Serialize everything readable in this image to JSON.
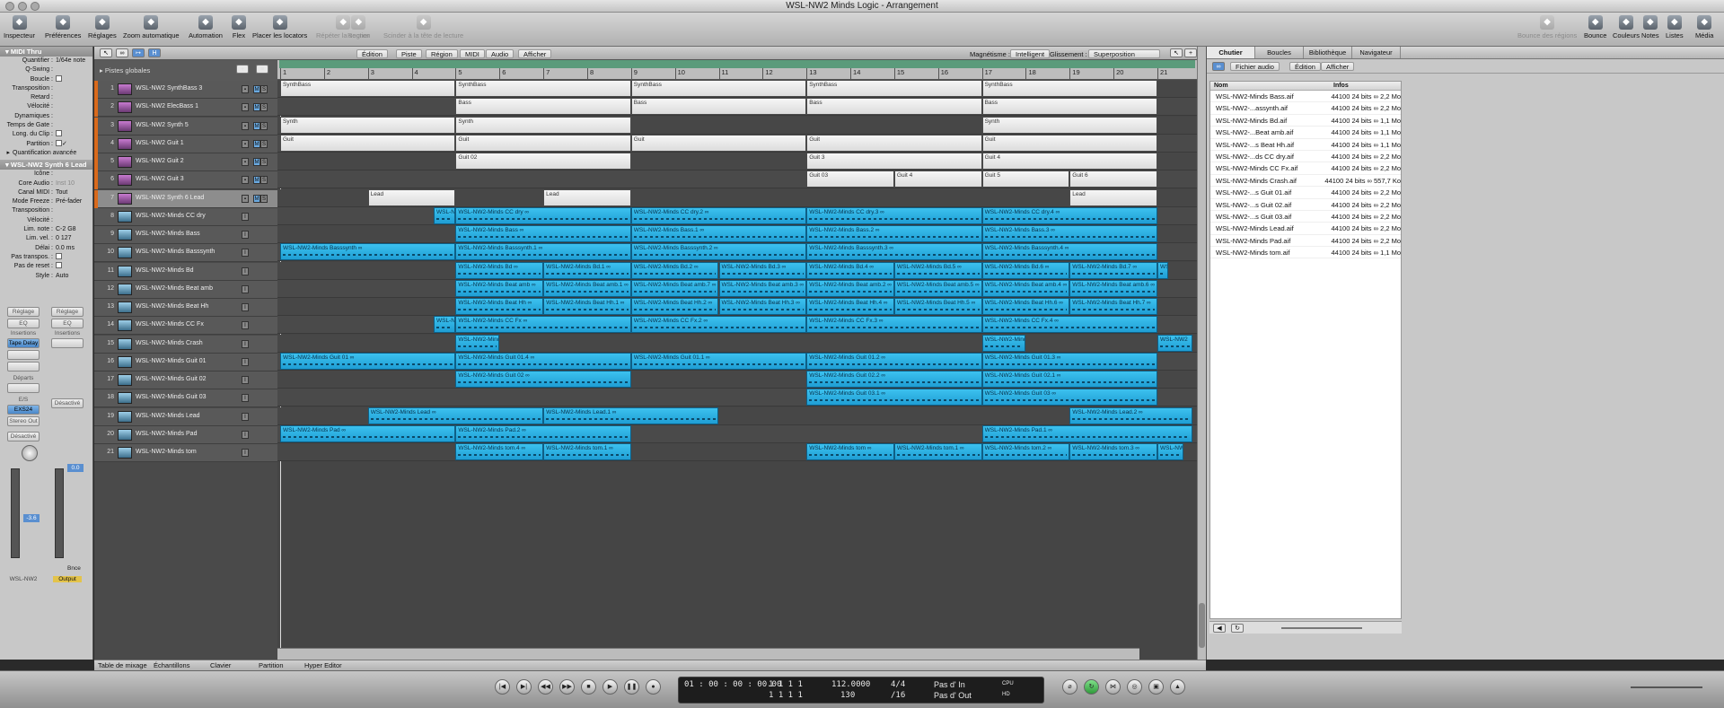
{
  "window": {
    "title": "WSL-NW2 Minds Logic - Arrangement"
  },
  "toolbar": {
    "left": [
      {
        "label": "Inspecteur",
        "icon": "info-icon"
      },
      {
        "label": "Préférences",
        "icon": "switch-icon"
      },
      {
        "label": "Réglages",
        "icon": "sliders-icon"
      },
      {
        "label": "Zoom automatique",
        "icon": "zoom-icon"
      },
      {
        "label": "Automation",
        "icon": "automation-icon"
      },
      {
        "label": "Flex",
        "icon": "flex-icon"
      },
      {
        "label": "Placer les locators",
        "icon": "locators-icon"
      },
      {
        "label": "Répéter la section",
        "icon": "repeat-icon",
        "disabled": true
      },
      {
        "label": "Rogner",
        "icon": "crop-icon",
        "disabled": true
      },
      {
        "label": "Scinder à la tête de lecture",
        "icon": "split-icon",
        "disabled": true
      }
    ],
    "right": [
      {
        "label": "Bounce des régions",
        "icon": "bounce-regions-icon",
        "disabled": true
      },
      {
        "label": "Bounce",
        "icon": "bounce-icon"
      },
      {
        "label": "Couleurs",
        "icon": "colors-icon"
      },
      {
        "label": "Notes",
        "icon": "notes-icon"
      },
      {
        "label": "Listes",
        "icon": "lists-icon"
      },
      {
        "label": "Média",
        "icon": "media-icon"
      }
    ]
  },
  "inspector": {
    "region_header": "MIDI Thru",
    "region_params": [
      {
        "k": "Quantifier :",
        "v": "1/64e note"
      },
      {
        "k": "Q-Swing :",
        "v": ""
      },
      {
        "k": "Boucle :",
        "v": "",
        "cb": true
      },
      {
        "k": "Transposition :",
        "v": ""
      },
      {
        "k": "Retard :",
        "v": ""
      },
      {
        "k": "Vélocité :",
        "v": ""
      },
      {
        "k": "Dynamiques :",
        "v": ""
      },
      {
        "k": "Temps de Gate :",
        "v": ""
      },
      {
        "k": "Long. du Clip :",
        "v": "",
        "cb": true
      },
      {
        "k": "Partition :",
        "v": "✓",
        "cb": true
      }
    ],
    "quant_adv": "Quantification avancée",
    "track_header": "WSL-NW2 Synth 6 Lead",
    "track_params": [
      {
        "k": "Icône :",
        "v": ""
      },
      {
        "k": "Core Audio :",
        "v": "Inst 10",
        "dim": true
      },
      {
        "k": "Canal MIDI :",
        "v": "Tout"
      },
      {
        "k": "Mode Freeze :",
        "v": "Pré-fader"
      },
      {
        "k": "Transposition :",
        "v": ""
      },
      {
        "k": "Vélocité :",
        "v": ""
      },
      {
        "k": "Lim. note :",
        "v": "C-2  G8"
      },
      {
        "k": "Lim. vel. :",
        "v": "0      127"
      },
      {
        "k": "Délai :",
        "v": "0.0 ms"
      },
      {
        "k": "Pas transpos. :",
        "v": "",
        "cb": true
      },
      {
        "k": "Pas de reset :",
        "v": "",
        "cb": true
      },
      {
        "k": "Style :",
        "v": "Auto"
      }
    ],
    "strip1": {
      "reglage": "Réglage",
      "eq": "EQ",
      "insertions": "Insertions",
      "insert1": "Tape Delay",
      "departs": "Départs",
      "es": "E/S",
      "input": "EXS24",
      "output": "Stereo Out",
      "mode": "Désactivé",
      "value": "-3.6",
      "name": "WSL-NW2"
    },
    "strip2": {
      "reglage": "Réglage",
      "eq": "EQ",
      "insertions": "Insertions",
      "mode": "Désactivé",
      "value": "0.0",
      "bnce": "Bnce",
      "name": "Output"
    }
  },
  "tracklist": {
    "globals": "Pistes globales"
  },
  "tracks": [
    {
      "n": "1",
      "name": "WSL-NW2 SynthBass 3",
      "type": "midi"
    },
    {
      "n": "2",
      "name": "WSL-NW2 ElecBass 1",
      "type": "midi"
    },
    {
      "n": "3",
      "name": "WSL-NW2 Synth 5",
      "type": "midi"
    },
    {
      "n": "4",
      "name": "WSL-NW2 Guit 1",
      "type": "midi"
    },
    {
      "n": "5",
      "name": "WSL-NW2 Guit 2",
      "type": "midi"
    },
    {
      "n": "6",
      "name": "WSL-NW2 Guit 3",
      "type": "midi"
    },
    {
      "n": "7",
      "name": "WSL-NW2 Synth 6 Lead",
      "type": "midi",
      "selected": true
    },
    {
      "n": "8",
      "name": "WSL-NW2-Minds CC dry",
      "type": "audio"
    },
    {
      "n": "9",
      "name": "WSL-NW2-Minds Bass",
      "type": "audio"
    },
    {
      "n": "10",
      "name": "WSL-NW2-Minds Basssynth",
      "type": "audio"
    },
    {
      "n": "11",
      "name": "WSL-NW2-Minds Bd",
      "type": "audio"
    },
    {
      "n": "12",
      "name": "WSL-NW2-Minds Beat amb",
      "type": "audio"
    },
    {
      "n": "13",
      "name": "WSL-NW2-Minds Beat Hh",
      "type": "audio"
    },
    {
      "n": "14",
      "name": "WSL-NW2-Minds CC Fx",
      "type": "audio"
    },
    {
      "n": "15",
      "name": "WSL-NW2-Minds Crash",
      "type": "audio"
    },
    {
      "n": "16",
      "name": "WSL-NW2-Minds Guit 01",
      "type": "audio"
    },
    {
      "n": "17",
      "name": "WSL-NW2-Minds Guit 02",
      "type": "audio"
    },
    {
      "n": "18",
      "name": "WSL-NW2-Minds Guit 03",
      "type": "audio"
    },
    {
      "n": "19",
      "name": "WSL-NW2-Minds Lead",
      "type": "audio"
    },
    {
      "n": "20",
      "name": "WSL-NW2-Minds Pad",
      "type": "audio"
    },
    {
      "n": "21",
      "name": "WSL-NW2-Minds tom",
      "type": "audio"
    }
  ],
  "arrange": {
    "menus": [
      "Édition",
      "Piste",
      "Région",
      "MIDI",
      "Audio",
      "Afficher"
    ],
    "magnet_label": "Magnétisme :",
    "magnet": "Intelligent",
    "glisse_label": "Glissement :",
    "glisse": "Superposition",
    "bars": [
      "1",
      "2",
      "3",
      "4",
      "5",
      "6",
      "7",
      "8",
      "9",
      "10",
      "11",
      "12",
      "13",
      "14",
      "15",
      "16",
      "17",
      "18",
      "19",
      "20",
      "21"
    ]
  },
  "regions": [
    {
      "t": 0,
      "s": 1,
      "e": 5,
      "label": "SynthBass",
      "k": "midi"
    },
    {
      "t": 0,
      "s": 5,
      "e": 9,
      "label": "SynthBass",
      "k": "midi"
    },
    {
      "t": 0,
      "s": 9,
      "e": 13,
      "label": "SynthBass",
      "k": "midi"
    },
    {
      "t": 0,
      "s": 13,
      "e": 17,
      "label": "SynthBass",
      "k": "midi"
    },
    {
      "t": 0,
      "s": 17,
      "e": 21,
      "label": "SynthBass",
      "k": "midi"
    },
    {
      "t": 1,
      "s": 5,
      "e": 9,
      "label": "Bass",
      "k": "midi"
    },
    {
      "t": 1,
      "s": 9,
      "e": 13,
      "label": "Bass",
      "k": "midi"
    },
    {
      "t": 1,
      "s": 13,
      "e": 17,
      "label": "Bass",
      "k": "midi"
    },
    {
      "t": 1,
      "s": 17,
      "e": 21,
      "label": "Bass",
      "k": "midi"
    },
    {
      "t": 2,
      "s": 1,
      "e": 5,
      "label": "Synth",
      "k": "midi"
    },
    {
      "t": 2,
      "s": 5,
      "e": 9,
      "label": "Synth",
      "k": "midi"
    },
    {
      "t": 2,
      "s": 17,
      "e": 21,
      "label": "Synth",
      "k": "midi"
    },
    {
      "t": 3,
      "s": 1,
      "e": 5,
      "label": "Guit",
      "k": "midi"
    },
    {
      "t": 3,
      "s": 5,
      "e": 9,
      "label": "Guit",
      "k": "midi"
    },
    {
      "t": 3,
      "s": 9,
      "e": 13,
      "label": "Guit",
      "k": "midi"
    },
    {
      "t": 3,
      "s": 13,
      "e": 17,
      "label": "Guit",
      "k": "midi"
    },
    {
      "t": 3,
      "s": 17,
      "e": 21,
      "label": "Guit",
      "k": "midi"
    },
    {
      "t": 4,
      "s": 5,
      "e": 9,
      "label": "Guit 02",
      "k": "midi"
    },
    {
      "t": 4,
      "s": 13,
      "e": 17,
      "label": "Guit 3",
      "k": "midi"
    },
    {
      "t": 4,
      "s": 17,
      "e": 21,
      "label": "Guit 4",
      "k": "midi"
    },
    {
      "t": 5,
      "s": 13,
      "e": 15,
      "label": "Guit 03",
      "k": "midi"
    },
    {
      "t": 5,
      "s": 15,
      "e": 17,
      "label": "Guit 4",
      "k": "midi"
    },
    {
      "t": 5,
      "s": 17,
      "e": 19,
      "label": "Guit 5",
      "k": "midi"
    },
    {
      "t": 5,
      "s": 19,
      "e": 21,
      "label": "Guit 6",
      "k": "midi"
    },
    {
      "t": 6,
      "s": 3,
      "e": 5,
      "label": "Lead",
      "k": "midi"
    },
    {
      "t": 6,
      "s": 7,
      "e": 9,
      "label": "Lead",
      "k": "midi"
    },
    {
      "t": 6,
      "s": 19,
      "e": 21,
      "label": "Lead",
      "k": "midi"
    },
    {
      "t": 7,
      "s": 4.5,
      "e": 5,
      "label": "WSL-N",
      "k": "audio"
    },
    {
      "t": 7,
      "s": 5,
      "e": 9,
      "label": "WSL-NW2-Minds CC dry ∞",
      "k": "audio"
    },
    {
      "t": 7,
      "s": 9,
      "e": 13,
      "label": "WSL-NW2-Minds CC dry.2 ∞",
      "k": "audio"
    },
    {
      "t": 7,
      "s": 13,
      "e": 17,
      "label": "WSL-NW2-Minds CC dry.3 ∞",
      "k": "audio"
    },
    {
      "t": 7,
      "s": 17,
      "e": 21,
      "label": "WSL-NW2-Minds CC dry.4 ∞",
      "k": "audio"
    },
    {
      "t": 8,
      "s": 5,
      "e": 9,
      "label": "WSL-NW2-Minds Bass ∞",
      "k": "audio"
    },
    {
      "t": 8,
      "s": 9,
      "e": 13,
      "label": "WSL-NW2-Minds Bass.1 ∞",
      "k": "audio"
    },
    {
      "t": 8,
      "s": 13,
      "e": 17,
      "label": "WSL-NW2-Minds Bass.2 ∞",
      "k": "audio"
    },
    {
      "t": 8,
      "s": 17,
      "e": 21,
      "label": "WSL-NW2-Minds Bass.3 ∞",
      "k": "audio"
    },
    {
      "t": 9,
      "s": 1,
      "e": 5,
      "label": "WSL-NW2-Minds Basssynth ∞",
      "k": "audio"
    },
    {
      "t": 9,
      "s": 5,
      "e": 9,
      "label": "WSL-NW2-Minds Basssynth.1 ∞",
      "k": "audio"
    },
    {
      "t": 9,
      "s": 9,
      "e": 13,
      "label": "WSL-NW2-Minds Basssynth.2 ∞",
      "k": "audio"
    },
    {
      "t": 9,
      "s": 13,
      "e": 17,
      "label": "WSL-NW2-Minds Basssynth.3 ∞",
      "k": "audio"
    },
    {
      "t": 9,
      "s": 17,
      "e": 21,
      "label": "WSL-NW2-Minds Basssynth.4 ∞",
      "k": "audio"
    },
    {
      "t": 10,
      "s": 5,
      "e": 7,
      "label": "WSL-NW2-Minds Bd ∞",
      "k": "audio"
    },
    {
      "t": 10,
      "s": 7,
      "e": 9,
      "label": "WSL-NW2-Minds Bd.1 ∞",
      "k": "audio"
    },
    {
      "t": 10,
      "s": 9,
      "e": 11,
      "label": "WSL-NW2-Minds Bd.2 ∞",
      "k": "audio"
    },
    {
      "t": 10,
      "s": 11,
      "e": 13,
      "label": "WSL-NW2-Minds Bd.3 ∞",
      "k": "audio"
    },
    {
      "t": 10,
      "s": 13,
      "e": 15,
      "label": "WSL-NW2-Minds Bd.4 ∞",
      "k": "audio"
    },
    {
      "t": 10,
      "s": 15,
      "e": 17,
      "label": "WSL-NW2-Minds Bd.5 ∞",
      "k": "audio"
    },
    {
      "t": 10,
      "s": 17,
      "e": 19,
      "label": "WSL-NW2-Minds Bd.6 ∞",
      "k": "audio"
    },
    {
      "t": 10,
      "s": 19,
      "e": 21,
      "label": "WSL-NW2-Minds Bd.7 ∞",
      "k": "audio"
    },
    {
      "t": 10,
      "s": 21,
      "e": 21.25,
      "label": "WS",
      "k": "audio"
    },
    {
      "t": 11,
      "s": 5,
      "e": 7,
      "label": "WSL-NW2-Minds Beat amb ∞",
      "k": "audio"
    },
    {
      "t": 11,
      "s": 7,
      "e": 9,
      "label": "WSL-NW2-Minds Beat amb.1 ∞",
      "k": "audio"
    },
    {
      "t": 11,
      "s": 9,
      "e": 11,
      "label": "WSL-NW2-Minds Beat amb.7 ∞",
      "k": "audio"
    },
    {
      "t": 11,
      "s": 11,
      "e": 13,
      "label": "WSL-NW2-Minds Beat amb.3 ∞",
      "k": "audio"
    },
    {
      "t": 11,
      "s": 13,
      "e": 15,
      "label": "WSL-NW2-Minds Beat amb.2 ∞",
      "k": "audio"
    },
    {
      "t": 11,
      "s": 15,
      "e": 17,
      "label": "WSL-NW2-Minds Beat amb.5 ∞",
      "k": "audio"
    },
    {
      "t": 11,
      "s": 17,
      "e": 19,
      "label": "WSL-NW2-Minds Beat amb.4 ∞",
      "k": "audio"
    },
    {
      "t": 11,
      "s": 19,
      "e": 21,
      "label": "WSL-NW2-Minds Beat amb.6 ∞",
      "k": "audio"
    },
    {
      "t": 12,
      "s": 5,
      "e": 7,
      "label": "WSL-NW2-Minds Beat Hh ∞",
      "k": "audio"
    },
    {
      "t": 12,
      "s": 7,
      "e": 9,
      "label": "WSL-NW2-Minds Beat Hh.1 ∞",
      "k": "audio"
    },
    {
      "t": 12,
      "s": 9,
      "e": 11,
      "label": "WSL-NW2-Minds Beat Hh.2 ∞",
      "k": "audio"
    },
    {
      "t": 12,
      "s": 11,
      "e": 13,
      "label": "WSL-NW2-Minds Beat Hh.3 ∞",
      "k": "audio"
    },
    {
      "t": 12,
      "s": 13,
      "e": 15,
      "label": "WSL-NW2-Minds Beat Hh.4 ∞",
      "k": "audio"
    },
    {
      "t": 12,
      "s": 15,
      "e": 17,
      "label": "WSL-NW2-Minds Beat Hh.5 ∞",
      "k": "audio"
    },
    {
      "t": 12,
      "s": 17,
      "e": 19,
      "label": "WSL-NW2-Minds Beat Hh.6 ∞",
      "k": "audio"
    },
    {
      "t": 12,
      "s": 19,
      "e": 21,
      "label": "WSL-NW2-Minds Beat Hh.7 ∞",
      "k": "audio"
    },
    {
      "t": 13,
      "s": 4.5,
      "e": 5,
      "label": "WSL-N",
      "k": "audio"
    },
    {
      "t": 13,
      "s": 5,
      "e": 9,
      "label": "WSL-NW2-Minds CC Fx ∞",
      "k": "audio"
    },
    {
      "t": 13,
      "s": 9,
      "e": 13,
      "label": "WSL-NW2-Minds CC Fx.2 ∞",
      "k": "audio"
    },
    {
      "t": 13,
      "s": 13,
      "e": 17,
      "label": "WSL-NW2-Minds CC Fx.3 ∞",
      "k": "audio"
    },
    {
      "t": 13,
      "s": 17,
      "e": 21,
      "label": "WSL-NW2-Minds CC Fx.4 ∞",
      "k": "audio"
    },
    {
      "t": 14,
      "s": 5,
      "e": 6,
      "label": "WSL-NW2-Mind",
      "k": "audio"
    },
    {
      "t": 14,
      "s": 17,
      "e": 18,
      "label": "WSL-NW2-Mind",
      "k": "audio"
    },
    {
      "t": 14,
      "s": 21,
      "e": 21.8,
      "label": "WSL-NW2",
      "k": "audio"
    },
    {
      "t": 15,
      "s": 1,
      "e": 5,
      "label": "WSL-NW2-Minds Guit 01 ∞",
      "k": "audio"
    },
    {
      "t": 15,
      "s": 5,
      "e": 9,
      "label": "WSL-NW2-Minds Guit 01.4 ∞",
      "k": "audio"
    },
    {
      "t": 15,
      "s": 9,
      "e": 13,
      "label": "WSL-NW2-Minds Guit 01.1 ∞",
      "k": "audio"
    },
    {
      "t": 15,
      "s": 13,
      "e": 17,
      "label": "WSL-NW2-Minds Guit 01.2 ∞",
      "k": "audio"
    },
    {
      "t": 15,
      "s": 17,
      "e": 21,
      "label": "WSL-NW2-Minds Guit 01.3 ∞",
      "k": "audio"
    },
    {
      "t": 16,
      "s": 5,
      "e": 9,
      "label": "WSL-NW2-Minds Guit 02 ∞",
      "k": "audio"
    },
    {
      "t": 16,
      "s": 13,
      "e": 17,
      "label": "WSL-NW2-Minds Guit 02.2 ∞",
      "k": "audio"
    },
    {
      "t": 16,
      "s": 17,
      "e": 21,
      "label": "WSL-NW2-Minds Guit 02.1 ∞",
      "k": "audio"
    },
    {
      "t": 17,
      "s": 13,
      "e": 17,
      "label": "WSL-NW2-Minds Guit 03.1 ∞",
      "k": "audio"
    },
    {
      "t": 17,
      "s": 17,
      "e": 21,
      "label": "WSL-NW2-Minds Guit 03 ∞",
      "k": "audio"
    },
    {
      "t": 18,
      "s": 3,
      "e": 7,
      "label": "WSL-NW2-Minds Lead ∞",
      "k": "audio"
    },
    {
      "t": 18,
      "s": 7,
      "e": 11,
      "label": "WSL-NW2-Minds Lead.1 ∞",
      "k": "audio"
    },
    {
      "t": 18,
      "s": 19,
      "e": 21.8,
      "label": "WSL-NW2-Minds Lead.2 ∞",
      "k": "audio"
    },
    {
      "t": 19,
      "s": 1,
      "e": 5,
      "label": "WSL-NW2-Minds Pad ∞",
      "k": "audio"
    },
    {
      "t": 19,
      "s": 5,
      "e": 9,
      "label": "WSL-NW2-Minds Pad.2 ∞",
      "k": "audio"
    },
    {
      "t": 19,
      "s": 17,
      "e": 21.8,
      "label": "WSL-NW2-Minds Pad.1 ∞",
      "k": "audio"
    },
    {
      "t": 20,
      "s": 5,
      "e": 7,
      "label": "WSL-NW2-Minds tom.4 ∞",
      "k": "audio"
    },
    {
      "t": 20,
      "s": 7,
      "e": 9,
      "label": "WSL-NW2-Minds tom.1 ∞",
      "k": "audio"
    },
    {
      "t": 20,
      "s": 13,
      "e": 15,
      "label": "WSL-NW2-Minds tom ∞",
      "k": "audio"
    },
    {
      "t": 20,
      "s": 15,
      "e": 17,
      "label": "WSL-NW2-Minds tom.1 ∞",
      "k": "audio"
    },
    {
      "t": 20,
      "s": 17,
      "e": 19,
      "label": "WSL-NW2-Minds tom.2 ∞",
      "k": "audio"
    },
    {
      "t": 20,
      "s": 19,
      "e": 21,
      "label": "WSL-NW2-Minds tom.3 ∞",
      "k": "audio"
    },
    {
      "t": 20,
      "s": 21,
      "e": 21.6,
      "label": "WSL-NW2",
      "k": "audio"
    }
  ],
  "browser": {
    "tabs": [
      "Chutier",
      "Boucles",
      "Bibliothèque",
      "Navigateur"
    ],
    "menus": [
      "Fichier audio",
      "Édition",
      "Afficher"
    ],
    "col_name": "Nom",
    "col_info": "Infos",
    "files": [
      {
        "name": "WSL-NW2-Minds Bass.aif",
        "info": "44100  24 bits  ∞  2,2 Mo"
      },
      {
        "name": "WSL-NW2-...assynth.aif",
        "info": "44100  24 bits  ∞  2,2 Mo"
      },
      {
        "name": "WSL-NW2-Minds Bd.aif",
        "info": "44100  24 bits  ∞  1,1 Mo"
      },
      {
        "name": "WSL-NW2-...Beat amb.aif",
        "info": "44100  24 bits  ∞  1,1 Mo"
      },
      {
        "name": "WSL-NW2-...s Beat Hh.aif",
        "info": "44100  24 bits  ∞  1,1 Mo"
      },
      {
        "name": "WSL-NW2-...ds CC dry.aif",
        "info": "44100  24 bits  ∞  2,2 Mo"
      },
      {
        "name": "WSL-NW2-Minds CC Fx.aif",
        "info": "44100  24 bits  ∞  2,2 Mo"
      },
      {
        "name": "WSL-NW2-Minds Crash.aif",
        "info": "44100  24 bits  ∞  557,7 Ko"
      },
      {
        "name": "WSL-NW2-...s Guit 01.aif",
        "info": "44100  24 bits  ∞  2,2 Mo"
      },
      {
        "name": "WSL-NW2-...s Guit 02.aif",
        "info": "44100  24 bits  ∞  2,2 Mo"
      },
      {
        "name": "WSL-NW2-...s Guit 03.aif",
        "info": "44100  24 bits  ∞  2,2 Mo"
      },
      {
        "name": "WSL-NW2-Minds Lead.aif",
        "info": "44100  24 bits  ∞  2,2 Mo"
      },
      {
        "name": "WSL-NW2-Minds Pad.aif",
        "info": "44100  24 bits  ∞  2,2 Mo"
      },
      {
        "name": "WSL-NW2-Minds tom.aif",
        "info": "44100  24 bits  ∞  1,1 Mo"
      }
    ]
  },
  "bottom_tabs": [
    "Table de mixage",
    "Échantillons",
    "Clavier",
    "Partition",
    "Hyper Editor"
  ],
  "transport": {
    "time": "01 : 00 : 00 : 00.00",
    "bbt": "1   1   1     1",
    "bbt2": "1   1   1     1",
    "pos2": "23   1   1     1",
    "tempo": "112.0000",
    "tempo2": "130",
    "sig": "4/4",
    "div": "/16",
    "in_label": "Pas d' In",
    "out_label": "Pas d' Out",
    "cpu": "CPU",
    "hd": "HD"
  }
}
